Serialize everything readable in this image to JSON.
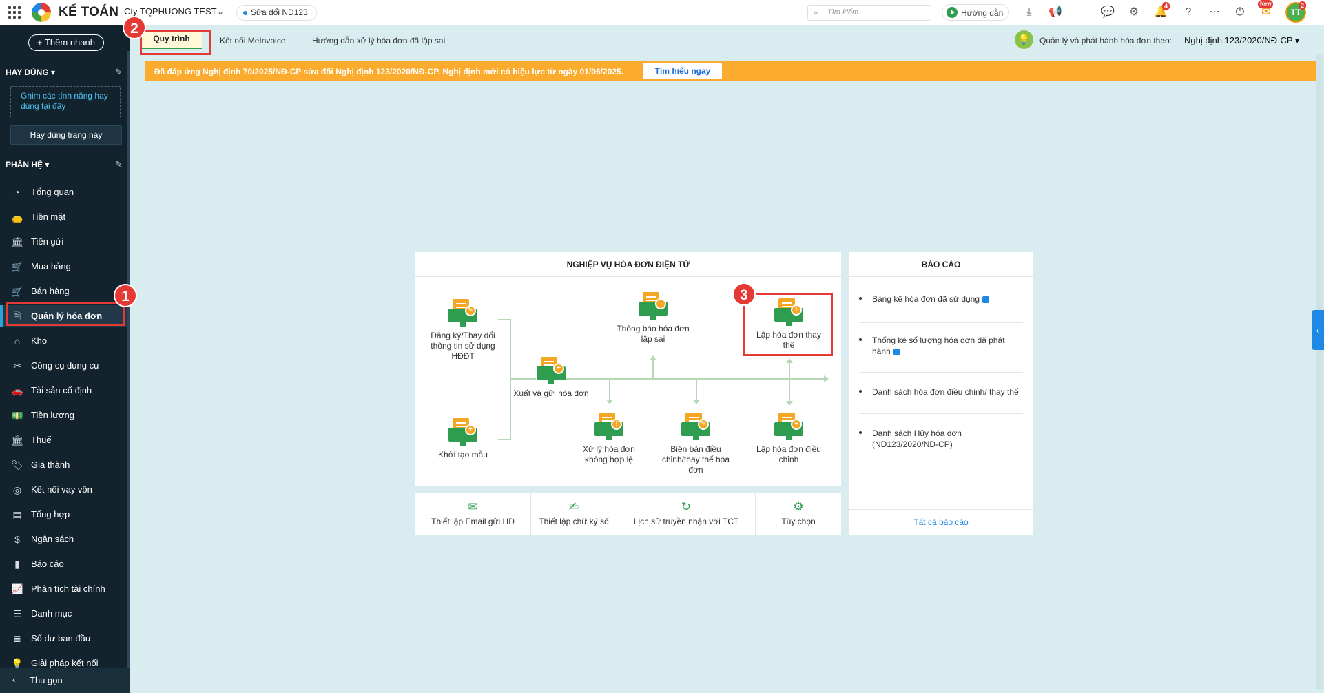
{
  "topbar": {
    "app_title": "KẾ TOÁN",
    "company": "Cty TQPHUONG TEST",
    "change_pill": "Sửa đổi NĐ123",
    "search_placeholder": "Tìm kiếm",
    "guide_label": "Hướng dẫn",
    "notification_count": "4",
    "new_badge": "New",
    "avatar_initials": "TT",
    "avatar_count": "2"
  },
  "sidebar": {
    "quick_add": "Thêm nhanh",
    "favorites_heading": "HAY DÙNG",
    "pin_hint": "Ghim các tính năng hay dùng tại đây",
    "favorite_this_page": "Hay dùng trang này",
    "modules_heading": "PHÂN HỆ",
    "items": [
      {
        "label": "Tổng quan",
        "icon": "gauge-icon"
      },
      {
        "label": "Tiền mặt",
        "icon": "money-bag-icon"
      },
      {
        "label": "Tiền gửi",
        "icon": "bank-icon"
      },
      {
        "label": "Mua hàng",
        "icon": "cart-icon"
      },
      {
        "label": "Bán hàng",
        "icon": "shopping-cart-icon"
      },
      {
        "label": "Quản lý hóa đơn",
        "icon": "invoice-icon"
      },
      {
        "label": "Kho",
        "icon": "warehouse-icon"
      },
      {
        "label": "Công cụ dụng cụ",
        "icon": "tools-icon"
      },
      {
        "label": "Tài sản cố định",
        "icon": "car-icon"
      },
      {
        "label": "Tiền lương",
        "icon": "payroll-icon"
      },
      {
        "label": "Thuế",
        "icon": "tax-icon"
      },
      {
        "label": "Giá thành",
        "icon": "price-tag-icon"
      },
      {
        "label": "Kết nối vay vốn",
        "icon": "loan-icon"
      },
      {
        "label": "Tổng hợp",
        "icon": "ledger-icon"
      },
      {
        "label": "Ngân sách",
        "icon": "budget-icon"
      },
      {
        "label": "Báo cáo",
        "icon": "bar-chart-icon"
      },
      {
        "label": "Phân tích tài chính",
        "icon": "line-chart-icon"
      },
      {
        "label": "Danh mục",
        "icon": "list-icon"
      },
      {
        "label": "Số dư ban đầu",
        "icon": "balance-icon"
      },
      {
        "label": "Giải pháp kết nối",
        "icon": "lightbulb-icon"
      }
    ],
    "active_index": 5,
    "collapse": "Thu gọn"
  },
  "tabs": [
    {
      "label": "Quy trình",
      "active": true
    },
    {
      "label": "Kết nối MeInvoice"
    },
    {
      "label": "Hướng dẫn xử lý hóa đơn đã lập sai"
    }
  ],
  "issue": {
    "label": "Quản lý và phát hành hóa đơn theo:",
    "decree": "Nghị định 123/2020/NĐ-CP"
  },
  "notice": {
    "text": "Đã đáp ứng Nghị định 70/2025/NĐ-CP sửa đổi Nghị định 123/2020/NĐ-CP. Nghị định mới có hiệu lực từ ngày 01/06/2025.",
    "button": "Tìm hiểu ngay"
  },
  "process": {
    "title": "NGHIỆP VỤ HÓA ĐƠN ĐIỆN TỬ",
    "nodes": {
      "register": "Đăng ký/Thay đổi thông tin sử dụng HĐĐT",
      "create_template": "Khởi tạo mẫu",
      "issue_send": "Xuất và gửi hóa đơn",
      "notify_error": "Thông báo hóa đơn lập sai",
      "replace": "Lập hóa đơn thay thế",
      "invalid": "Xử lý hóa đơn không hợp lệ",
      "minutes": "Biên bản điều chỉnh/thay thế hóa đơn",
      "adjust": "Lập hóa đơn điều chỉnh"
    }
  },
  "settings": [
    {
      "label": "Thiết lập Email gửi HĐ",
      "icon": "envelope-icon"
    },
    {
      "label": "Thiết lập chữ ký số",
      "icon": "signature-icon"
    },
    {
      "label": "Lịch sử truyền nhận với TCT",
      "icon": "history-icon"
    },
    {
      "label": "Tùy chọn",
      "icon": "gear-icon"
    }
  ],
  "reports": {
    "title": "BÁO CÁO",
    "items": [
      "Bảng kê hóa đơn đã sử dụng",
      "Thống kê số lượng hóa đơn đã phát hành",
      "Danh sách hóa đơn điều chỉnh/ thay thế",
      "Danh sách Hủy hóa đơn (NĐ123/2020/NĐ-CP)"
    ],
    "all": "Tất cả báo cáo"
  },
  "annotations": [
    "1",
    "2",
    "3"
  ],
  "colors": {
    "sidebar_bg": "#12232e",
    "accent_green": "#2e9d4f",
    "notice_orange": "#fbab2e",
    "annotation_red": "#e53935",
    "page_bg": "#d9edf0"
  }
}
